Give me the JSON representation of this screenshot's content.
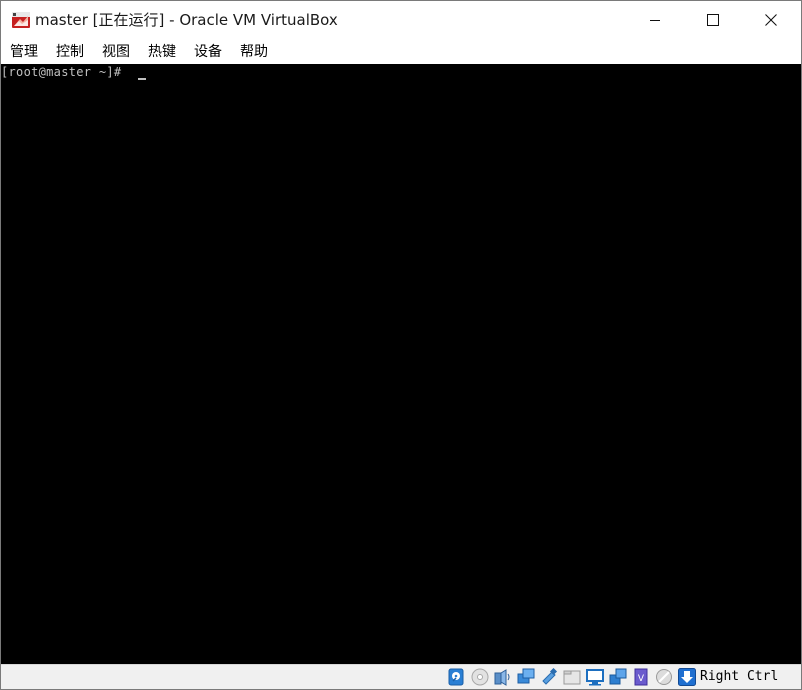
{
  "window": {
    "title": "master [正在运行] - Oracle VM VirtualBox",
    "app_icon": "virtualbox-vm-icon"
  },
  "caption_buttons": [
    "minimize-icon",
    "maximize-icon",
    "close-icon"
  ],
  "menu": {
    "items": [
      {
        "label": "管理"
      },
      {
        "label": "控制"
      },
      {
        "label": "视图"
      },
      {
        "label": "热键"
      },
      {
        "label": "设备"
      },
      {
        "label": "帮助"
      }
    ]
  },
  "terminal": {
    "prompt": "[root@master ~]#",
    "text_color": "#c0c0c0",
    "background": "#000000"
  },
  "statusbar": {
    "icons": [
      "hard-disk-icon",
      "optical-drive-icon",
      "audio-icon",
      "network-icon",
      "usb-icon",
      "shared-folders-icon",
      "display-icon",
      "video-capture-icon",
      "virtualization-icon",
      "mouse-integration-icon",
      "keyboard-capture-icon"
    ],
    "host_key": "Right Ctrl"
  }
}
